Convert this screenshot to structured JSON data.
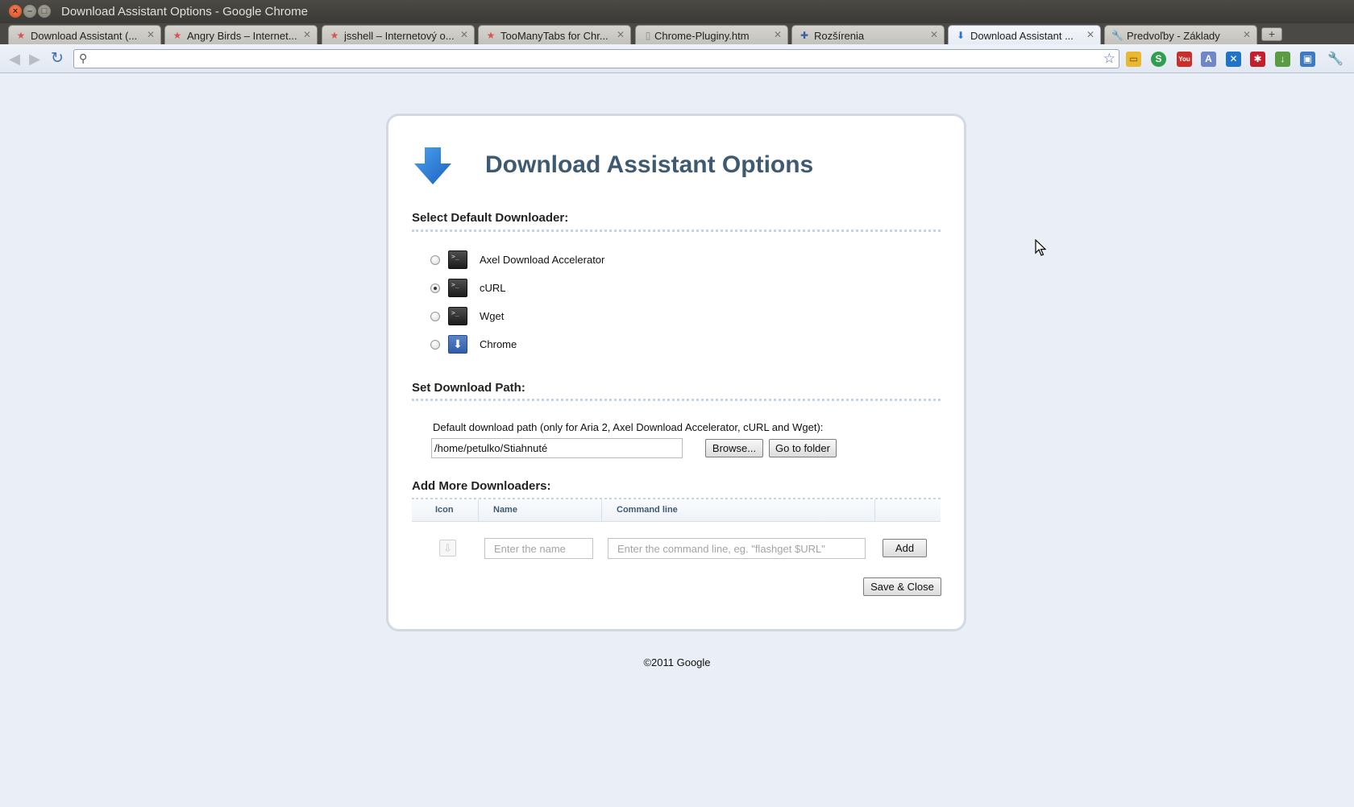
{
  "window": {
    "title": "Download Assistant Options - Google Chrome"
  },
  "tabs": [
    {
      "label": "Download Assistant (...",
      "icon": "chrome-webstore-icon"
    },
    {
      "label": "Angry Birds – Internet...",
      "icon": "chrome-webstore-icon"
    },
    {
      "label": "jsshell – Internetový o...",
      "icon": "chrome-webstore-icon"
    },
    {
      "label": "TooManyTabs for Chr...",
      "icon": "chrome-webstore-icon"
    },
    {
      "label": "Chrome-Pluginy.htm",
      "icon": "page-icon"
    },
    {
      "label": "Rozšírenia",
      "icon": "puzzle-icon"
    },
    {
      "label": "Download Assistant ...",
      "icon": "download-icon"
    },
    {
      "label": "Predvoľby - Základy",
      "icon": "wrench-icon"
    }
  ],
  "omnibox": {
    "value": ""
  },
  "page": {
    "title": "Download Assistant Options",
    "select_heading": "Select Default Downloader:",
    "downloaders": [
      {
        "label": "Axel Download Accelerator",
        "icon": "terminal-icon",
        "selected": false
      },
      {
        "label": "cURL",
        "icon": "terminal-icon",
        "selected": true
      },
      {
        "label": "Wget",
        "icon": "terminal-icon",
        "selected": false
      },
      {
        "label": "Chrome",
        "icon": "chrome-download-icon",
        "selected": false
      }
    ],
    "path_heading": "Set Download Path:",
    "path_note": "Default download path (only for Aria 2, Axel Download Accelerator, cURL and Wget):",
    "path_value": "/home/petulko/Stiahnuté",
    "browse_label": "Browse...",
    "goto_label": "Go to folder",
    "add_heading": "Add More Downloaders:",
    "table_headers": {
      "icon": "Icon",
      "name": "Name",
      "command": "Command line"
    },
    "name_placeholder": "Enter the name",
    "command_placeholder": "Enter the command line, eg. \"flashget $URL\"",
    "add_label": "Add",
    "save_label": "Save & Close",
    "footer": "©2011 Google"
  },
  "colors": {
    "title": "#3e5a72",
    "accent_blue": "#2f74d0",
    "page_bg": "#e9eef7"
  }
}
